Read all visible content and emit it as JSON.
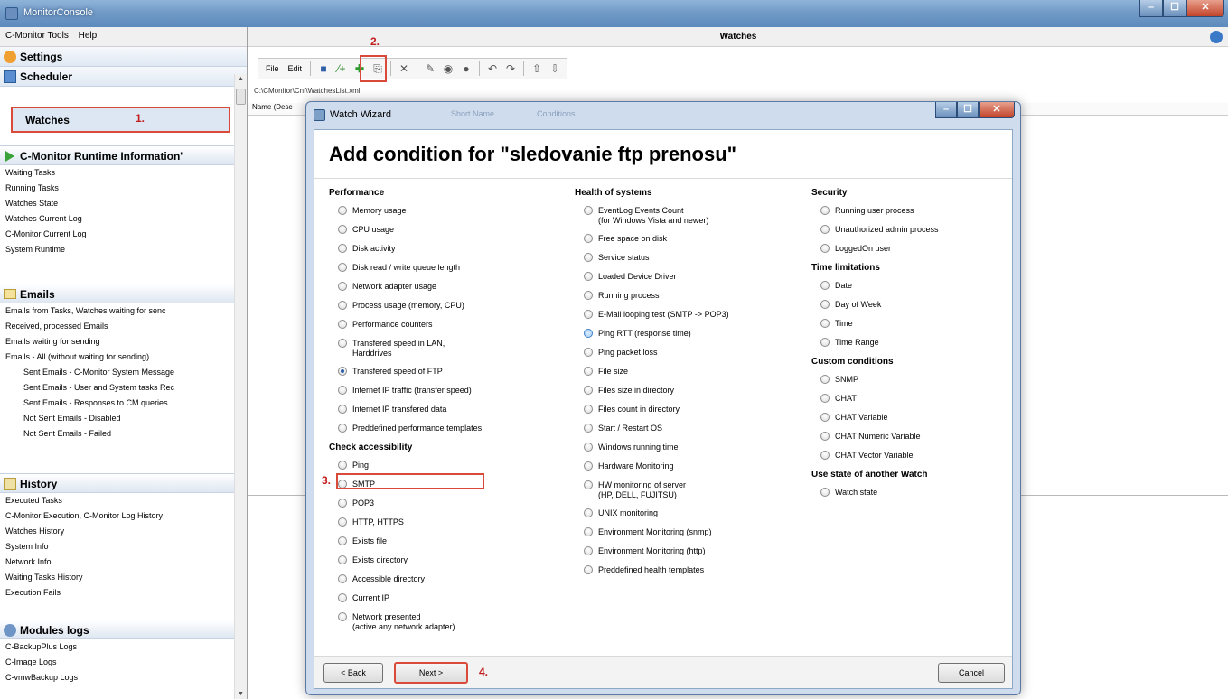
{
  "app": {
    "title": "MonitorConsole",
    "win_minimize": "–",
    "win_maximize": "☐",
    "win_close": "✕"
  },
  "left": {
    "menu": [
      "C-Monitor Tools",
      "Help"
    ],
    "settings": "Settings",
    "scheduler": "Scheduler",
    "watches": "Watches",
    "step1": "1.",
    "runtime": {
      "title": "C-Monitor Runtime Information'",
      "items": [
        "Waiting Tasks",
        "Running Tasks",
        "Watches State",
        "Watches Current Log",
        "C-Monitor Current Log",
        "System Runtime"
      ]
    },
    "emails": {
      "title": "Emails",
      "items": [
        "Emails from Tasks, Watches waiting for senc",
        "Received, processed Emails",
        "Emails waiting for sending",
        "Emails - All (without waiting for sending)"
      ],
      "subitems": [
        "Sent Emails - C-Monitor System Message",
        "Sent Emails - User and System tasks Rec",
        "Sent Emails - Responses to CM queries",
        "Not Sent Emails - Disabled",
        "Not Sent Emails - Failed"
      ]
    },
    "history": {
      "title": "History",
      "items": [
        "Executed Tasks",
        "C-Monitor Execution, C-Monitor Log History",
        "Watches History",
        "System Info",
        "Network Info",
        "Waiting Tasks History",
        "Execution Fails"
      ]
    },
    "modules": {
      "title": "Modules logs",
      "items": [
        "C-BackupPlus Logs",
        "C-Image Logs",
        "C-vmwBackup Logs"
      ]
    }
  },
  "right": {
    "title": "Watches",
    "file_menu": "File",
    "edit_menu": "Edit",
    "step2": "2.",
    "path": "C:\\CMonitor\\Cnf\\WatchesList.xml",
    "grid_col": "Name (Desc"
  },
  "dialog": {
    "title": "Watch Wizard",
    "title_shadow_1": "Short Name",
    "title_shadow_2": "Conditions",
    "heading": "Add condition for \"sledovanie ftp prenosu\"",
    "col1": {
      "perf_title": "Performance",
      "perf": [
        "Memory usage",
        "CPU usage",
        "Disk activity",
        "Disk read / write queue length",
        "Network adapter usage",
        "Process usage (memory, CPU)",
        "Performance counters",
        "Transfered speed in LAN,\nHarddrives",
        "Transfered speed of FTP",
        "Internet IP traffic (transfer speed)",
        "Internet IP transfered data",
        "Preddefined performance templates"
      ],
      "access_title": "Check accessibility",
      "access": [
        "Ping",
        "SMTP",
        "POP3",
        "HTTP, HTTPS",
        "Exists file",
        "Exists directory",
        "Accessible directory",
        "Current IP",
        "Network presented\n(active any network adapter)"
      ]
    },
    "col2": {
      "health_title": "Health of systems",
      "health": [
        "EventLog Events Count\n(for Windows Vista and newer)",
        "Free space on disk",
        "Service status",
        "Loaded Device Driver",
        "Running process",
        "E-Mail looping test (SMTP -> POP3)",
        "Ping RTT (response time)",
        "Ping packet loss",
        "File size",
        "Files size in directory",
        "Files count in directory",
        "Start / Restart OS",
        "Windows running time",
        "Hardware Monitoring",
        "HW monitoring of server\n(HP, DELL, FUJITSU)",
        "UNIX monitoring",
        "Environment Monitoring (snmp)",
        "Environment Monitoring (http)",
        "Preddefined health templates"
      ]
    },
    "col3": {
      "security_title": "Security",
      "security": [
        "Running user process",
        "Unauthorized admin process",
        "LoggedOn user"
      ],
      "time_title": "Time limitations",
      "time": [
        "Date",
        "Day of Week",
        "Time",
        "Time Range"
      ],
      "custom_title": "Custom conditions",
      "custom": [
        "SNMP",
        "CHAT",
        "CHAT Variable",
        "CHAT Numeric Variable",
        "CHAT Vector Variable"
      ],
      "another_title": "Use state of another Watch",
      "another": [
        "Watch state"
      ]
    },
    "step3": "3.",
    "step4": "4.",
    "back": "< Back",
    "next": "Next >",
    "cancel": "Cancel"
  },
  "colors": {
    "highlight": "#d94a3a",
    "step_text": "#c21c1c",
    "dialog_frame": "#cfdced"
  }
}
